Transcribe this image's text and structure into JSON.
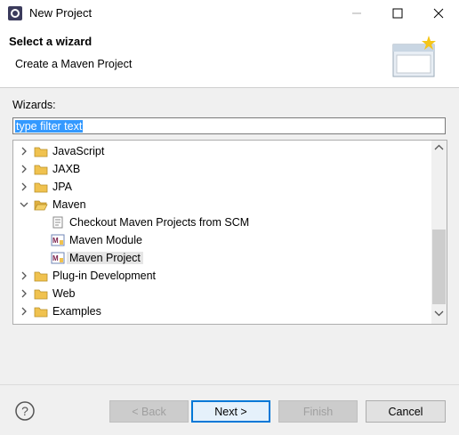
{
  "window": {
    "title": "New Project"
  },
  "header": {
    "title": "Select a wizard",
    "description": "Create a Maven Project"
  },
  "wizards": {
    "label": "Wizards:",
    "filter_text": "type filter text"
  },
  "tree": {
    "items": [
      {
        "label": "JavaScript",
        "expanded": false
      },
      {
        "label": "JAXB",
        "expanded": false
      },
      {
        "label": "JPA",
        "expanded": false
      },
      {
        "label": "Maven",
        "expanded": true
      },
      {
        "label": "Checkout Maven Projects from SCM"
      },
      {
        "label": "Maven Module"
      },
      {
        "label": "Maven Project",
        "selected": true
      },
      {
        "label": "Plug-in Development",
        "expanded": false
      },
      {
        "label": "Web",
        "expanded": false
      },
      {
        "label": "Examples",
        "expanded": false
      }
    ]
  },
  "buttons": {
    "back": "< Back",
    "next": "Next >",
    "finish": "Finish",
    "cancel": "Cancel"
  },
  "icons": {
    "help": "help-icon",
    "folder": "folder-icon",
    "maven": "maven-icon",
    "scm": "scm-checkout-icon"
  },
  "colors": {
    "selection": "#3399ff",
    "default_button_border": "#0078d7",
    "folder": "#f0c24f"
  }
}
